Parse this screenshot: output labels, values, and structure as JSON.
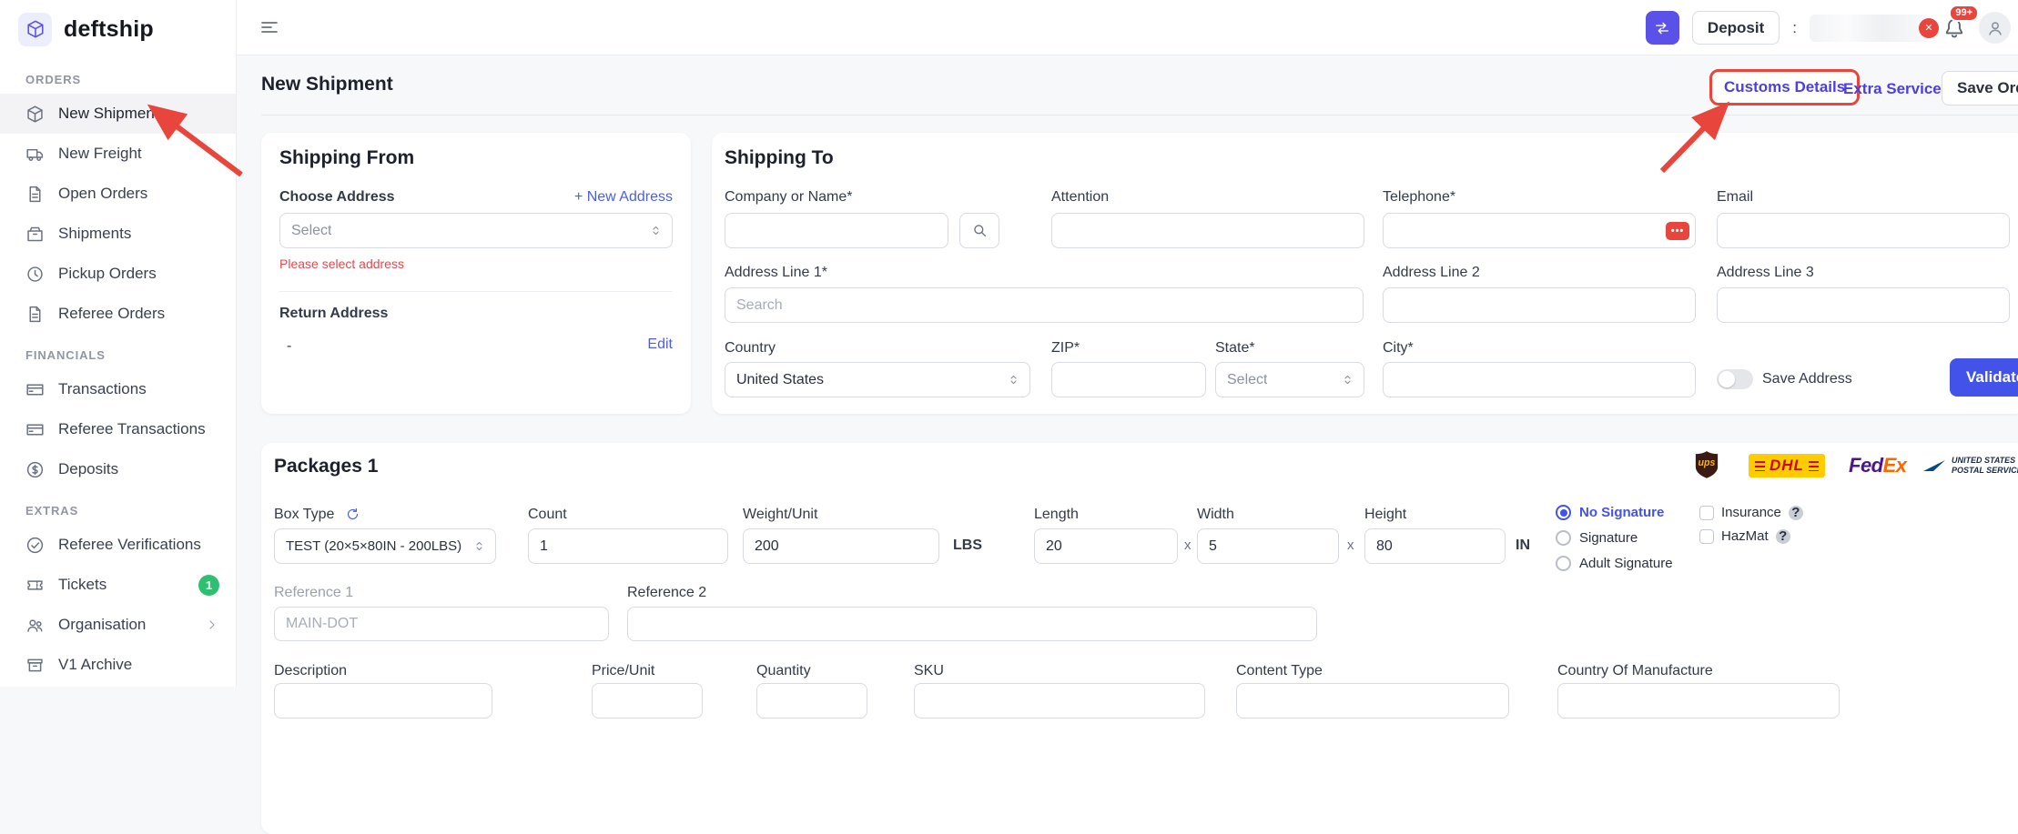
{
  "brand": {
    "name": "deftship"
  },
  "sidebar": {
    "sections": [
      {
        "title": "ORDERS",
        "items": [
          {
            "label": "New Shipment"
          },
          {
            "label": "New Freight"
          },
          {
            "label": "Open Orders"
          },
          {
            "label": "Shipments"
          },
          {
            "label": "Pickup Orders"
          },
          {
            "label": "Referee Orders"
          }
        ]
      },
      {
        "title": "FINANCIALS",
        "items": [
          {
            "label": "Transactions"
          },
          {
            "label": "Referee Transactions"
          },
          {
            "label": "Deposits"
          }
        ]
      },
      {
        "title": "EXTRAS",
        "items": [
          {
            "label": "Referee Verifications"
          },
          {
            "label": "Tickets",
            "badge": "1"
          },
          {
            "label": "Organisation"
          },
          {
            "label": "V1 Archive"
          }
        ]
      }
    ]
  },
  "topbar": {
    "deposit_label": "Deposit",
    "account_prefix": ":",
    "notification_badge": "99+"
  },
  "page": {
    "title": "New Shipment",
    "customs_details_label": "Customs Details",
    "extra_services_label": "Extra Services",
    "save_order_label": "Save Order"
  },
  "shipping_from": {
    "title": "Shipping From",
    "choose_address_label": "Choose Address",
    "new_address_link": "+ New Address",
    "address_select_value": "Select",
    "error_text": "Please select address",
    "return_address_label": "Return Address",
    "return_address_value": "-",
    "edit_link": "Edit"
  },
  "shipping_to": {
    "title": "Shipping To",
    "company_label": "Company or Name*",
    "attention_label": "Attention",
    "telephone_label": "Telephone*",
    "email_label": "Email",
    "address1_label": "Address Line 1*",
    "address1_placeholder": "Search",
    "address2_label": "Address Line 2",
    "address3_label": "Address Line 3",
    "country_label": "Country",
    "country_value": "United States",
    "zip_label": "ZIP*",
    "state_label": "State*",
    "state_value": "Select",
    "city_label": "City*",
    "save_address_label": "Save Address",
    "validate_button": "Validate"
  },
  "packages": {
    "title": "Packages 1",
    "box_type_label": "Box Type",
    "box_type_value": "TEST (20×5×80IN - 200LBS)",
    "count_label": "Count",
    "count_value": "1",
    "weight_label": "Weight/Unit",
    "weight_value": "200",
    "weight_unit": "LBS",
    "length_label": "Length",
    "length_value": "20",
    "width_label": "Width",
    "width_value": "5",
    "height_label": "Height",
    "height_value": "80",
    "dimension_unit": "IN",
    "multiply_symbol": "x",
    "signature_options": [
      "No Signature",
      "Signature",
      "Adult Signature"
    ],
    "signature_selected": "No Signature",
    "insurance_label": "Insurance",
    "hazmat_label": "HazMat",
    "reference1_label": "Reference 1",
    "reference1_placeholder": "MAIN-DOT",
    "reference2_label": "Reference 2",
    "item_columns": [
      "Description",
      "Price/Unit",
      "Quantity",
      "SKU",
      "Content Type",
      "Country Of Manufacture"
    ],
    "carriers": {
      "ups": "ups",
      "dhl": "DHL",
      "fedex_part1": "Fed",
      "fedex_part2": "Ex",
      "usps_line1": "UNITED STATES",
      "usps_line2": "POSTAL SERVICE"
    }
  },
  "colors": {
    "brand_purple": "#5b51e8",
    "link_blue": "#4c5fe4",
    "validate_blue": "#4353e9",
    "annotation_red": "#e8453c",
    "error_red": "#e5484d",
    "badge_green": "#2fbf71",
    "dhl_yellow": "#ffcc00",
    "dhl_red": "#d40511",
    "fedex_purple": "#4d148c",
    "fedex_orange": "#ff6600",
    "ups_brown": "#3a1a12",
    "ups_gold": "#f6b21b",
    "usps_blue": "#004b87"
  }
}
